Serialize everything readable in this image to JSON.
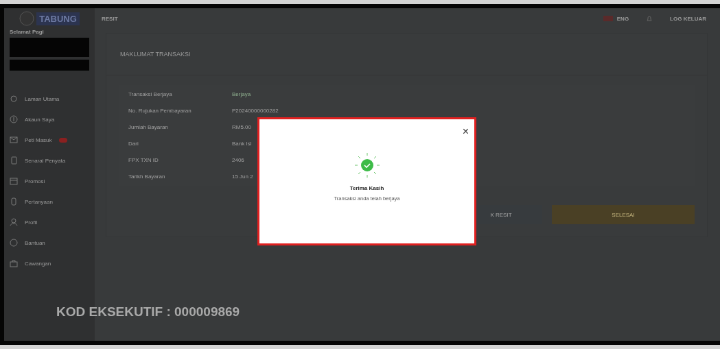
{
  "header": {
    "logo": "TABUNG",
    "page_title": "RESIT",
    "language": "ENG",
    "logout": "LOG KELUAR"
  },
  "sidebar": {
    "greeting": "Selamat Pagi",
    "items": [
      {
        "label": "Laman Utama",
        "badge": false
      },
      {
        "label": "Akaun Saya",
        "badge": false
      },
      {
        "label": "Peti Masuk",
        "badge": true
      },
      {
        "label": "Senarai Penyata",
        "badge": false
      },
      {
        "label": "Promosi",
        "badge": false
      },
      {
        "label": "Pertanyaan",
        "badge": false
      },
      {
        "label": "Profil",
        "badge": false
      },
      {
        "label": "Bantuan",
        "badge": false
      },
      {
        "label": "Cawangan",
        "badge": false
      }
    ]
  },
  "panel": {
    "title": "MAKLUMAT TRANSAKSI",
    "rows": [
      {
        "label": "Transaksi Berjaya",
        "value": "Berjaya",
        "kind": "status"
      },
      {
        "label": "No. Rujukan Pembayaran",
        "value": "P20240000000282",
        "kind": "text"
      },
      {
        "label": "Jumlah Bayaran",
        "value": "RM5.00",
        "kind": "text"
      },
      {
        "label": "Dari",
        "value": "Bank Isl",
        "kind": "text"
      },
      {
        "label": "FPX TXN ID",
        "value": "2406",
        "kind": "text"
      },
      {
        "label": "Tarikh Bayaran",
        "value": "15 Jun 2",
        "kind": "text"
      }
    ],
    "buttons": [
      {
        "label": "K RESIT",
        "kind": "secondary"
      },
      {
        "label": "SELESAI",
        "kind": "primary"
      }
    ]
  },
  "caption": "KOD EKSEKUTIF : 000009869",
  "dialog": {
    "close": "×",
    "title": "Terima Kasih",
    "message": "Transaksi anda telah berjaya"
  }
}
